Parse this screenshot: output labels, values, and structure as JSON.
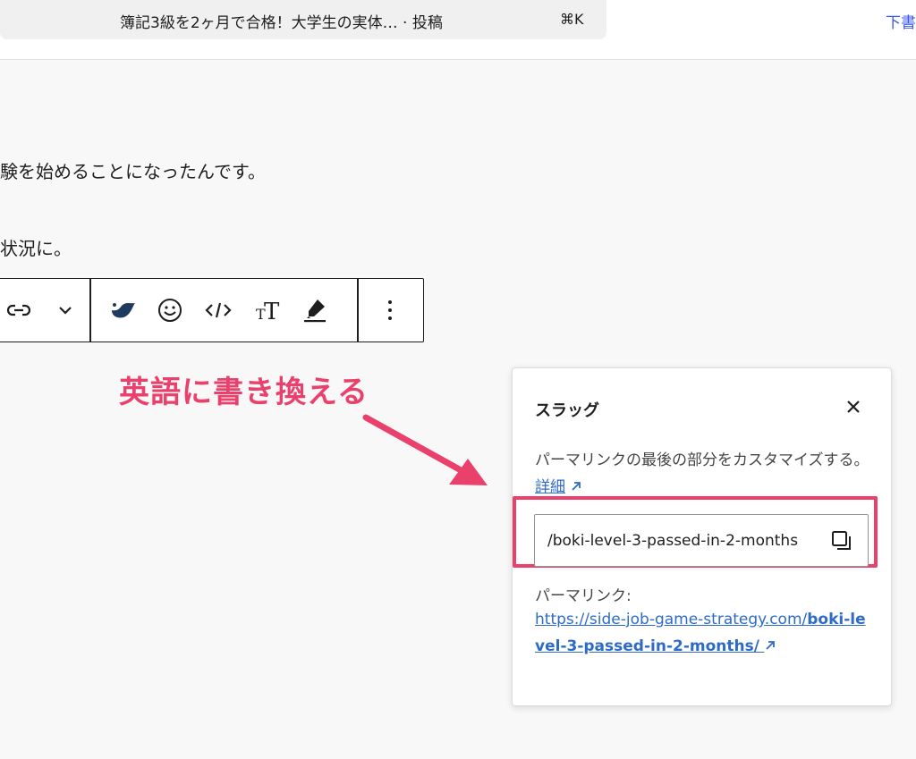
{
  "header": {
    "command_title": "簿記3級を2ヶ月で合格！大学生の実体… · 投稿",
    "command_shortcut": "⌘K",
    "draft_label": "下書"
  },
  "content": {
    "paragraph_1": "験を始めることになったんです。",
    "paragraph_2": "状況に。"
  },
  "toolbar": {
    "icons": [
      "link-icon",
      "chevron-down-icon",
      "custom-block-icon",
      "emoji-icon",
      "code-icon",
      "text-size-icon",
      "highlight-icon",
      "more-options-icon"
    ]
  },
  "annotation": {
    "text": "英語に書き換える",
    "color": "#e9416c"
  },
  "slug_popover": {
    "title": "スラッグ",
    "description": "パーマリンクの最後の部分をカスタマイズする。",
    "learn_more": "詳細",
    "slug_value": "/boki-level-3-passed-in-2-months",
    "permalink_label": "パーマリンク:",
    "permalink_base": "https://side-job-game-strategy.com/",
    "permalink_slug": "boki-level-3-passed-in-2-months/"
  },
  "colors": {
    "accent_pink": "#e9416c",
    "link_blue": "#2e6bc6",
    "wp_blue": "#3858e9"
  }
}
